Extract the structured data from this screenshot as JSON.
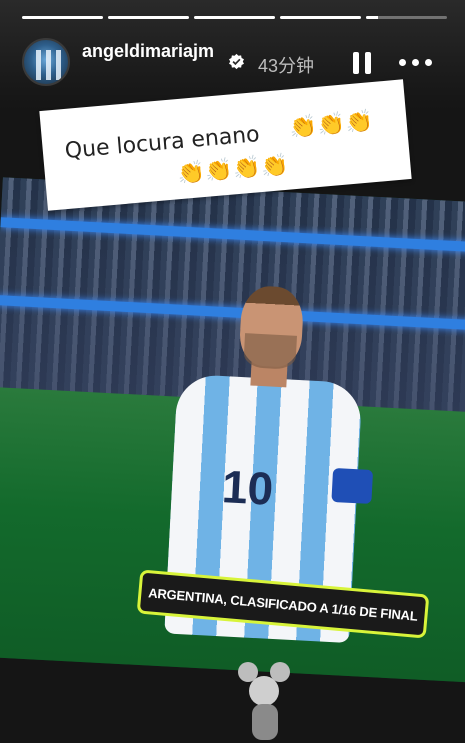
{
  "story": {
    "progress_segments": [
      {
        "filled": 1
      },
      {
        "filled": 1
      },
      {
        "filled": 1
      },
      {
        "filled": 1
      },
      {
        "filled": 0.15
      }
    ],
    "header": {
      "username": "angeldimariajm",
      "time_ago": "43分钟",
      "avatar_icon": "avatar-icon",
      "verified_icon": "verified-badge-icon",
      "pause_icon": "pause-icon",
      "more_icon": "more-icon"
    },
    "caption": {
      "text": "Que locura enano",
      "clap_emoji": "👏",
      "clap_count_line1": 3,
      "clap_count_line2": 4
    },
    "media": {
      "jersey_number": "10",
      "tv_banner": "ARGENTINA, CLASIFICADO A 1/16 DE FINAL",
      "sticker_icon": "mickey-sticker-icon"
    }
  }
}
